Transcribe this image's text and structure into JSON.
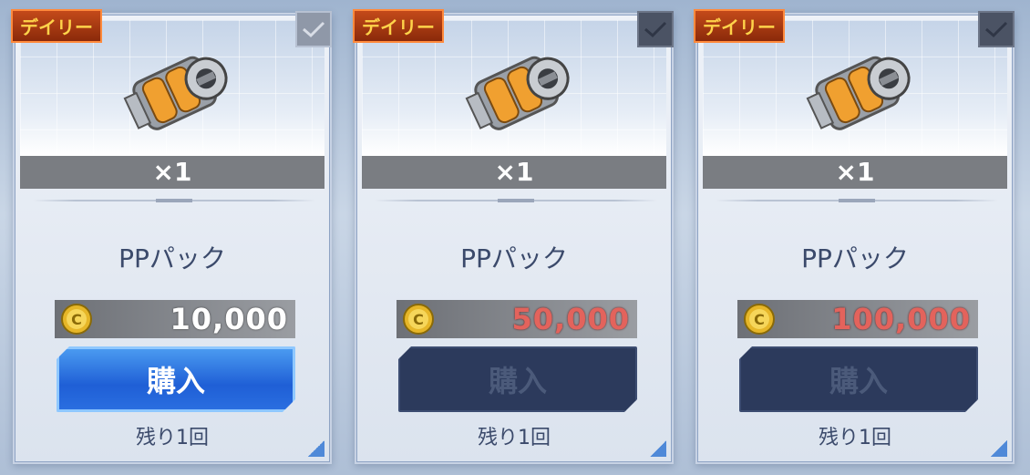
{
  "cards": [
    {
      "tag": "デイリー",
      "qty": "×1",
      "name": "PPパック",
      "price": "10,000",
      "buy_label": "購入",
      "remaining": "残り1回"
    },
    {
      "tag": "デイリー",
      "qty": "×1",
      "name": "PPパック",
      "price": "50,000",
      "buy_label": "購入",
      "remaining": "残り1回"
    },
    {
      "tag": "デイリー",
      "qty": "×1",
      "name": "PPパック",
      "price": "100,000",
      "buy_label": "購入",
      "remaining": "残り1回"
    }
  ]
}
